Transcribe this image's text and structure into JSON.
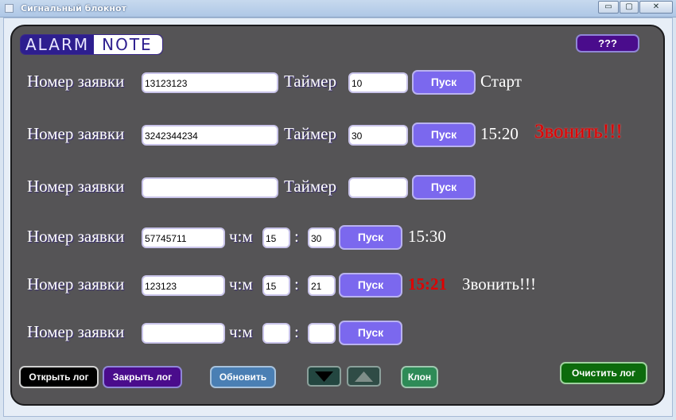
{
  "window": {
    "title": "Сигнальный блокнот",
    "minimize": "▭",
    "restore": "▢",
    "close": "✕"
  },
  "logo": {
    "part1": "ALARM",
    "part2": "NOTE"
  },
  "help_button": "???",
  "rows": [
    {
      "label": "Номер заявки",
      "id_value": "13123123",
      "timer_label": "Таймер",
      "timer_value": "10",
      "go": "Пуск",
      "status": "Старт"
    },
    {
      "label": "Номер заявки",
      "id_value": "3242344234",
      "timer_label": "Таймер",
      "timer_value": "30",
      "go": "Пуск",
      "time": "15:20",
      "alert": "Звонить!!!"
    },
    {
      "label": "Номер заявки",
      "id_value": "",
      "timer_label": "Таймер",
      "timer_value": "",
      "go": "Пуск"
    },
    {
      "label": "Номер заявки",
      "id_value": "57745711",
      "hm_label": "ч:м",
      "hours": "15",
      "sep": ":",
      "minutes": "30",
      "go": "Пуск",
      "time": "15:30"
    },
    {
      "label": "Номер заявки",
      "id_value": "123123",
      "hm_label": "ч:м",
      "hours": "15",
      "sep": ":",
      "minutes": "21",
      "go": "Пуск",
      "time": "15:21",
      "alert": "Звонить!!!"
    },
    {
      "label": "Номер заявки",
      "id_value": "",
      "hm_label": "ч:м",
      "hours": "",
      "sep": ":",
      "minutes": "",
      "go": "Пуск"
    }
  ],
  "bottom": {
    "open_log": "Открыть лог",
    "close_log": "Закрыть лог",
    "refresh": "Обновить",
    "down_icon": "triangle-down",
    "up_icon": "triangle-up",
    "clone": "Клон",
    "clear_log": "Очистить лог"
  },
  "colors": {
    "panel": "#555456",
    "go_button": "#7b68ee",
    "alert": "#e00000",
    "clear_log": "#0c6b0c"
  }
}
